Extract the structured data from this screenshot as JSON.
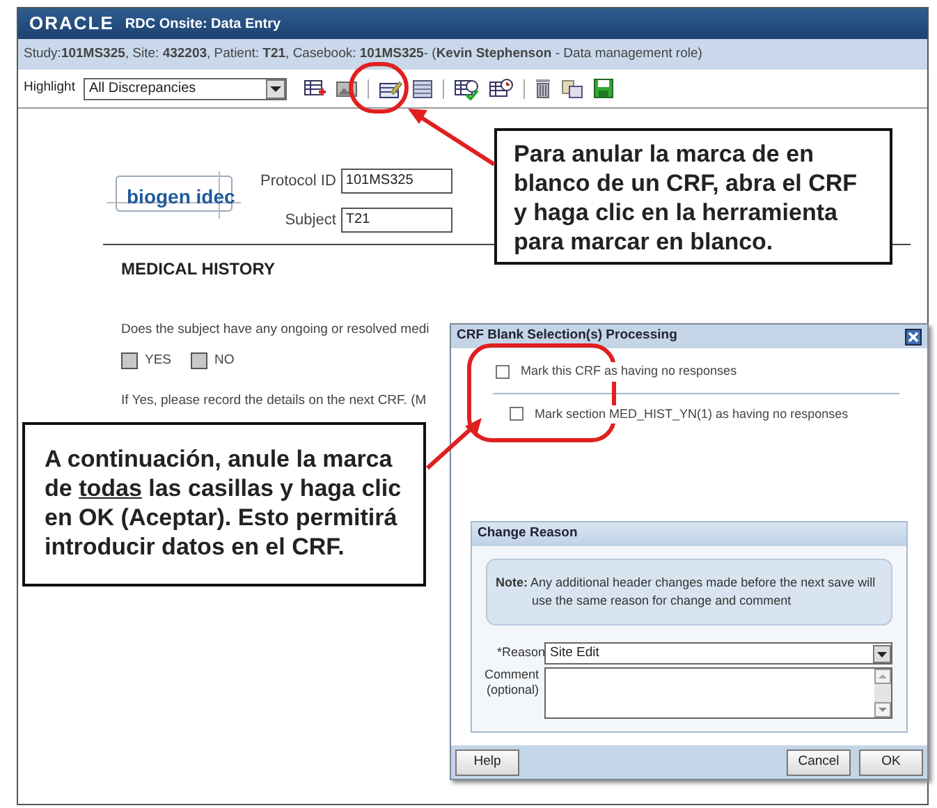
{
  "window": {
    "logo": "ORACLE",
    "title": "RDC Onsite: Data Entry"
  },
  "info_bar": "Study:**101MS325**, Site: **432203**, Patient: **T21**, Casebook: **101MS325**- (**Kevin Stephenson** - Data management role)",
  "toolbar": {
    "highlight_label": "Highlight",
    "highlight_value": "All Discrepancies"
  },
  "form": {
    "logo": "biogen idec",
    "fields": [
      {
        "label": "Protocol ID",
        "value": "101MS325"
      },
      {
        "label": "Subject",
        "value": "T21"
      }
    ],
    "section_title": "MEDICAL HISTORY",
    "question": "Does the subject have any ongoing or resolved medi",
    "options": [
      {
        "label": "YES",
        "checked": false
      },
      {
        "label": "NO",
        "checked": false
      }
    ],
    "instruction": "If Yes, please record the details on the next CRF. (M"
  },
  "dialog": {
    "title": "CRF Blank Selection(s) Processing",
    "checkboxes": [
      {
        "label": "Mark this CRF as having no responses",
        "checked": false
      },
      {
        "label": "Mark section MED_HIST_YN(1) as having no responses",
        "checked": false
      }
    ],
    "change_reason": {
      "title": "Change Reason",
      "note": "**Note:** Any additional header changes made before the next save will use the same reason for change and comment",
      "reason_label": "*Reason",
      "reason_value": "Site Edit",
      "comment_label": "Comment (optional)"
    },
    "buttons": [
      "Help",
      "Cancel",
      "OK"
    ]
  },
  "callouts": [
    {
      "parts": [
        {
          "text": "Para anular la marca de en blanco de un CRF, abra el CRF y haga clic en la herramienta para marcar en blanco.",
          "underlined": false
        }
      ]
    },
    {
      "parts": [
        {
          "text": "A continuación, anule la marca de ",
          "underlined": false
        },
        {
          "text": "todas",
          "underlined": true
        },
        {
          "text": " las casillas y haga clic en OK (Aceptar). Esto permitirá introducir datos en el CRF.",
          "underlined": false
        }
      ]
    }
  ]
}
